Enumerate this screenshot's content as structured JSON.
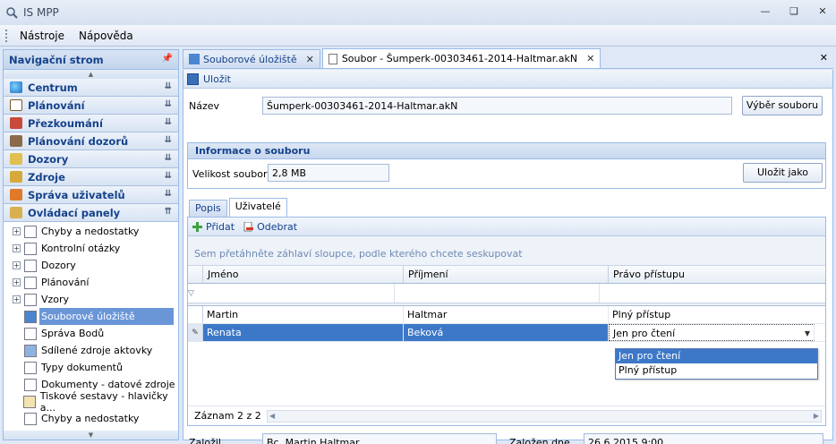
{
  "window": {
    "title": "IS MPP"
  },
  "menu": {
    "items": [
      "Nástroje",
      "Nápověda"
    ]
  },
  "nav": {
    "header": "Navigační strom",
    "groups": [
      {
        "label": "Centrum",
        "icon": "globe-icon"
      },
      {
        "label": "Plánování",
        "icon": "calendar-icon"
      },
      {
        "label": "Přezkoumání",
        "icon": "review-icon"
      },
      {
        "label": "Plánování dozorů",
        "icon": "handshake-icon"
      },
      {
        "label": "Dozory",
        "icon": "eye-icon"
      },
      {
        "label": "Zdroje",
        "icon": "resources-icon"
      },
      {
        "label": "Správa uživatelů",
        "icon": "users-icon"
      },
      {
        "label": "Ovládací panely",
        "icon": "control-panel-icon"
      }
    ],
    "tree": [
      {
        "label": "Chyby a nedostatky",
        "expandable": true
      },
      {
        "label": "Kontrolní otázky",
        "expandable": true
      },
      {
        "label": "Dozory",
        "expandable": true
      },
      {
        "label": "Plánování",
        "expandable": true
      },
      {
        "label": "Vzory",
        "expandable": true
      },
      {
        "label": "Souborové úložiště",
        "expandable": false,
        "selected": true
      },
      {
        "label": "Správa Bodů",
        "expandable": false
      },
      {
        "label": "Sdílené zdroje aktovky",
        "expandable": false
      },
      {
        "label": "Typy dokumentů",
        "expandable": false
      },
      {
        "label": "Dokumenty - datové zdroje",
        "expandable": false
      },
      {
        "label": "Tiskové sestavy - hlavičky a...",
        "expandable": false
      },
      {
        "label": "Chyby a nedostatky",
        "expandable": false
      }
    ]
  },
  "tabs": [
    {
      "label": "Souborové úložiště",
      "active": false
    },
    {
      "label": "Soubor - Šumperk-00303461-2014-Haltmar.akN",
      "active": true
    }
  ],
  "toolbar": {
    "save_label": "Uložit"
  },
  "form": {
    "name_label": "Název",
    "name_value": "Šumperk-00303461-2014-Haltmar.akN",
    "select_file_button": "Výběr souboru",
    "info_header": "Informace o souboru",
    "size_label": "Velikost souboru",
    "size_value": "2,8 MB",
    "save_as_button": "Uložit jako",
    "created_by_label": "Založil",
    "created_by_value": "Bc. Martin Haltmar",
    "created_on_label": "Založen dne",
    "created_on_value": "26.6.2015 9:00"
  },
  "subtabs": [
    {
      "label": "Popis",
      "active": false
    },
    {
      "label": "Uživatelé",
      "active": true
    }
  ],
  "users": {
    "add_label": "Přidat",
    "remove_label": "Odebrat",
    "group_hint": "Sem přetáhněte záhlaví sloupce, podle kterého chcete seskupovat",
    "columns": [
      "Jméno",
      "Příjmení",
      "Právo přístupu"
    ],
    "rows": [
      [
        "Martin",
        "Haltmar",
        "Plný přístup"
      ],
      [
        "Renata",
        "Beková",
        "Jen pro čtení"
      ]
    ],
    "dropdown_options": [
      "Jen pro čtení",
      "Plný přístup"
    ],
    "pager_label": "Záznam 2 z 2"
  }
}
